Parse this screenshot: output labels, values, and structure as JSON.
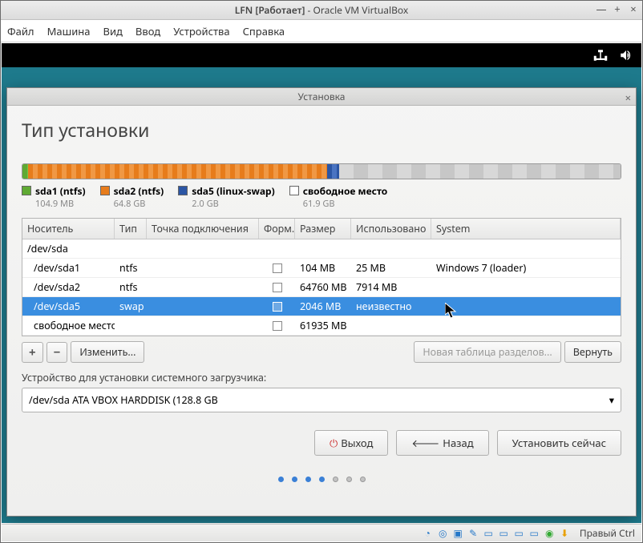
{
  "vm_title_prefix": "LFN [Работает]",
  "vm_title_suffix": " - Oracle VM VirtualBox",
  "menubar": [
    "Файл",
    "Машина",
    "Вид",
    "Ввод",
    "Устройства",
    "Справка"
  ],
  "installer_title": "Установка",
  "installer_heading": "Тип установки",
  "legend": [
    {
      "color": "#5faa33",
      "label": "sda1 (ntfs)",
      "sub": "104.9 MB"
    },
    {
      "color": "#e77c1b",
      "label": "sda2 (ntfs)",
      "sub": "64.8 GB"
    },
    {
      "color": "#2c56a4",
      "label": "sda5 (linux-swap)",
      "sub": "2.0 GB"
    },
    {
      "color": "#ffffff",
      "label": "свободное место",
      "sub": "61.9 GB"
    }
  ],
  "table": {
    "headers": {
      "dev": "Носитель",
      "type": "Тип",
      "mount": "Точка подключения",
      "fmt": "Форм.?",
      "size": "Размер",
      "used": "Использовано",
      "sys": "System"
    },
    "parent": "/dev/sda",
    "rows": [
      {
        "dev": "/dev/sda1",
        "type": "ntfs",
        "size": "104 MB",
        "used": "25 MB",
        "sys": "Windows 7 (loader)"
      },
      {
        "dev": "/dev/sda2",
        "type": "ntfs",
        "size": "64760 MB",
        "used": "7914 MB",
        "sys": ""
      },
      {
        "dev": "/dev/sda5",
        "type": "swap",
        "size": "2046 MB",
        "used": "неизвестно",
        "sys": "",
        "selected": true
      },
      {
        "dev": "свободное место",
        "type": "",
        "size": "61935 MB",
        "used": "",
        "sys": ""
      }
    ]
  },
  "buttons": {
    "plus": "+",
    "minus": "−",
    "change": "Изменить...",
    "newtable": "Новая таблица разделов...",
    "revert": "Вернуть"
  },
  "bootloader_label": "Устройство для установки системного загрузчика:",
  "bootloader_value": "/dev/sda   ATA VBOX HARDDISK (128.8 GB",
  "footer": {
    "quit": "Выход",
    "back": "Назад",
    "install": "Установить сейчас"
  },
  "status_hostkey": "Правый Ctrl"
}
